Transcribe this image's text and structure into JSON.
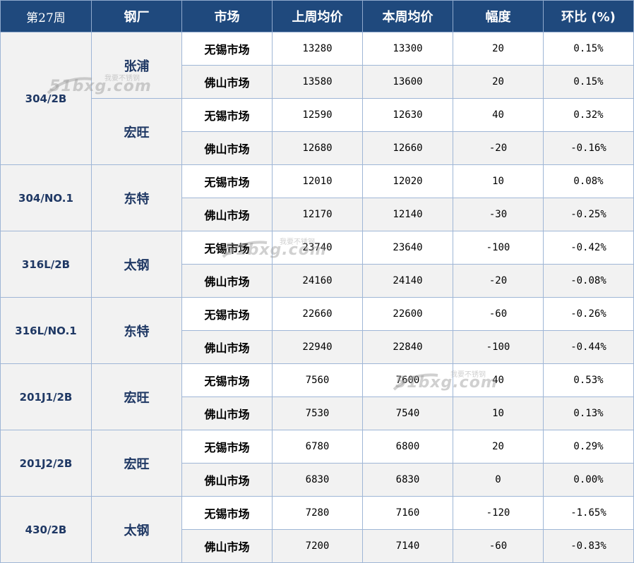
{
  "headers": {
    "week": "第27周",
    "mill": "钢厂",
    "market": "市场",
    "last_avg": "上周均价",
    "this_avg": "本周均价",
    "change": "幅度",
    "pct": "环比 (%)"
  },
  "groups": [
    {
      "grade": "304/2B",
      "mills": [
        {
          "name": "张浦",
          "rows": [
            {
              "market": "无锡市场",
              "last": "13280",
              "this": "13300",
              "change": "20",
              "pct": "0.15%",
              "trend": "up"
            },
            {
              "market": "佛山市场",
              "last": "13580",
              "this": "13600",
              "change": "20",
              "pct": "0.15%",
              "trend": "up"
            }
          ]
        },
        {
          "name": "宏旺",
          "rows": [
            {
              "market": "无锡市场",
              "last": "12590",
              "this": "12630",
              "change": "40",
              "pct": "0.32%",
              "trend": "up"
            },
            {
              "market": "佛山市场",
              "last": "12680",
              "this": "12660",
              "change": "-20",
              "pct": "-0.16%",
              "trend": "down"
            }
          ]
        }
      ]
    },
    {
      "grade": "304/NO.1",
      "mills": [
        {
          "name": "东特",
          "rows": [
            {
              "market": "无锡市场",
              "last": "12010",
              "this": "12020",
              "change": "10",
              "pct": "0.08%",
              "trend": "up"
            },
            {
              "market": "佛山市场",
              "last": "12170",
              "this": "12140",
              "change": "-30",
              "pct": "-0.25%",
              "trend": "down"
            }
          ]
        }
      ]
    },
    {
      "grade": "316L/2B",
      "mills": [
        {
          "name": "太钢",
          "rows": [
            {
              "market": "无锡市场",
              "last": "23740",
              "this": "23640",
              "change": "-100",
              "pct": "-0.42%",
              "trend": "down"
            },
            {
              "market": "佛山市场",
              "last": "24160",
              "this": "24140",
              "change": "-20",
              "pct": "-0.08%",
              "trend": "down"
            }
          ]
        }
      ]
    },
    {
      "grade": "316L/NO.1",
      "mills": [
        {
          "name": "东特",
          "rows": [
            {
              "market": "无锡市场",
              "last": "22660",
              "this": "22600",
              "change": "-60",
              "pct": "-0.26%",
              "trend": "down"
            },
            {
              "market": "佛山市场",
              "last": "22940",
              "this": "22840",
              "change": "-100",
              "pct": "-0.44%",
              "trend": "down"
            }
          ]
        }
      ]
    },
    {
      "grade": "201J1/2B",
      "mills": [
        {
          "name": "宏旺",
          "rows": [
            {
              "market": "无锡市场",
              "last": "7560",
              "this": "7600",
              "change": "40",
              "pct": "0.53%",
              "trend": "up"
            },
            {
              "market": "佛山市场",
              "last": "7530",
              "this": "7540",
              "change": "10",
              "pct": "0.13%",
              "trend": "up"
            }
          ]
        }
      ]
    },
    {
      "grade": "201J2/2B",
      "mills": [
        {
          "name": "宏旺",
          "rows": [
            {
              "market": "无锡市场",
              "last": "6780",
              "this": "6800",
              "change": "20",
              "pct": "0.29%",
              "trend": "up"
            },
            {
              "market": "佛山市场",
              "last": "6830",
              "this": "6830",
              "change": "0",
              "pct": "0.00%",
              "trend": "flat"
            }
          ]
        }
      ]
    },
    {
      "grade": "430/2B",
      "mills": [
        {
          "name": "太钢",
          "rows": [
            {
              "market": "无锡市场",
              "last": "7280",
              "this": "7160",
              "change": "-120",
              "pct": "-1.65%",
              "trend": "down"
            },
            {
              "market": "佛山市场",
              "last": "7200",
              "this": "7140",
              "change": "-60",
              "pct": "-0.83%",
              "trend": "down"
            }
          ]
        }
      ]
    }
  ],
  "watermark": {
    "brand": "51bxg.com",
    "tagline": "我要不锈钢"
  },
  "colors": {
    "header_bg": "#1f497d",
    "up": "#c00000",
    "down": "#00a050"
  }
}
